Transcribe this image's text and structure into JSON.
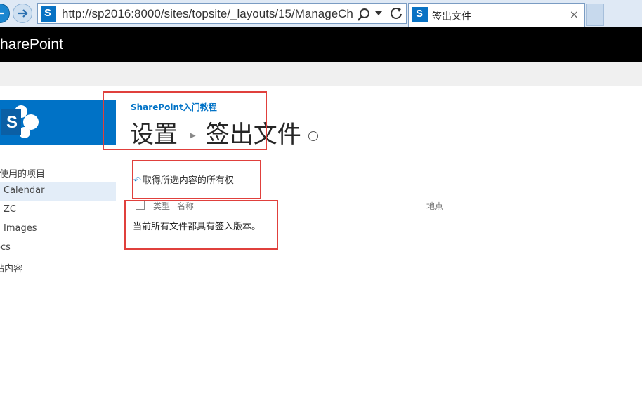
{
  "browser": {
    "url": "http://sp2016:8000/sites/topsite/_layouts/15/ManageCh",
    "tab_title": "签出文件",
    "tab_close": "×",
    "favicon_letter": "S"
  },
  "suite_bar": {
    "brand": "SharePoint"
  },
  "site": {
    "title": "SharePoint入门教程",
    "logo_letter": "S"
  },
  "page": {
    "breadcrumb_parent": "设置",
    "breadcrumb_sep": "▶",
    "title": "签出文件",
    "info": "i"
  },
  "quick_launch": {
    "recent_heading": "近使用的项目",
    "items": [
      {
        "label": "Calendar",
        "selected": true
      },
      {
        "label": "ZC",
        "selected": false
      },
      {
        "label": "Images",
        "selected": false
      }
    ],
    "docs": "ocs",
    "site_contents": "站内容"
  },
  "content": {
    "take_ownership": "取得所选内容的所有权",
    "columns": {
      "type": "类型",
      "name": "名称",
      "location": "地点"
    },
    "empty_message": "当前所有文件都具有签入版本。"
  },
  "colors": {
    "accent": "#0072c6",
    "suite_bar": "#000000",
    "annotation": "#e0403c"
  }
}
